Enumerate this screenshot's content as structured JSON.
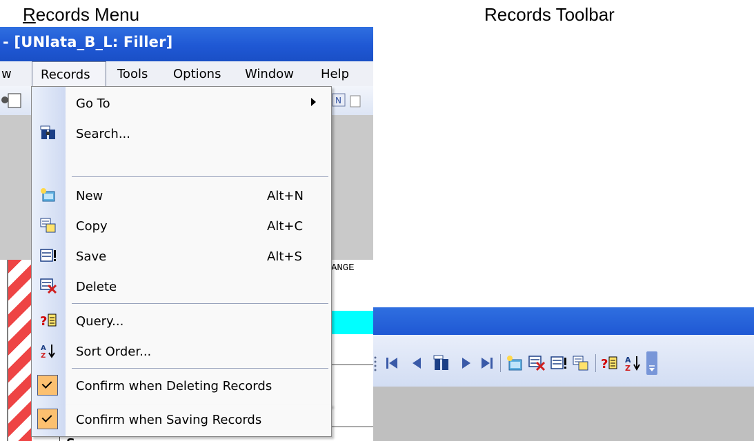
{
  "headings": {
    "left": "Records Menu",
    "right": "Records Toolbar"
  },
  "window": {
    "title": "- [UNlata_B_L: Filler]"
  },
  "menubar": {
    "items": [
      "w",
      "Records",
      "Tools",
      "Options",
      "Window",
      "Help"
    ],
    "active": "Records"
  },
  "records_menu": {
    "items": [
      {
        "label": "Go To",
        "icon": "none",
        "submenu": true
      },
      {
        "label": "Search...",
        "icon": "binoculars-icon"
      },
      {
        "label": "New",
        "shortcut": "Alt+N",
        "icon": "new-record-icon"
      },
      {
        "label": "Copy",
        "shortcut": "Alt+C",
        "icon": "copy-record-icon"
      },
      {
        "label": "Save",
        "shortcut": "Alt+S",
        "icon": "save-record-icon"
      },
      {
        "label": "Delete",
        "icon": "delete-record-icon"
      },
      {
        "label": "Query...",
        "icon": "query-icon"
      },
      {
        "label": "Sort Order...",
        "icon": "sort-icon"
      },
      {
        "label": "Confirm when Deleting Records",
        "checked": true
      },
      {
        "label": "Confirm when Saving Records",
        "checked": true
      }
    ]
  },
  "background_text": {
    "column_fragment": "ANGE",
    "bottom_word": "S"
  },
  "records_toolbar": {
    "buttons": [
      "first-record-icon",
      "previous-record-icon",
      "search-icon",
      "next-record-icon",
      "last-record-icon",
      "new-record-icon",
      "delete-record-icon",
      "save-record-icon",
      "copy-record-icon",
      "query-icon",
      "sort-icon",
      "toolbar-options-icon"
    ]
  },
  "colors": {
    "title_bar": "#1f58d4",
    "menu_check": "#fcc070",
    "cyan_row": "#00ffff"
  }
}
